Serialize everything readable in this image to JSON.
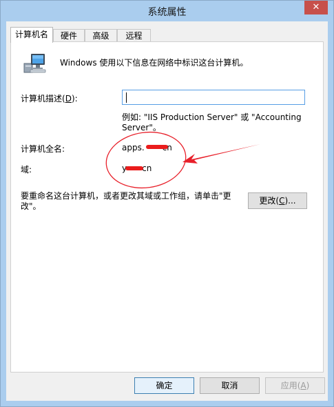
{
  "window": {
    "title": "系统属性",
    "close_label": "✕"
  },
  "tabs": [
    {
      "label": "计算机名",
      "active": true
    },
    {
      "label": "硬件",
      "active": false
    },
    {
      "label": "高级",
      "active": false
    },
    {
      "label": "远程",
      "active": false
    }
  ],
  "computer_name": {
    "intro": "Windows 使用以下信息在网络中标识这台计算机。",
    "description_label_pre": "计算机描述(",
    "description_label_key": "D",
    "description_label_post": "):",
    "description_value": "",
    "example_text": "例如: \"IIS Production Server\" 或 \"Accounting Server\"。",
    "full_name_label": "计算机全名:",
    "full_name_prefix": "apps.",
    "full_name_suffix": "cn",
    "domain_label": "域:",
    "domain_prefix": "y",
    "domain_suffix": "cn",
    "rename_hint": "要重命名这台计算机，或者更改其域或工作组，请单击\"更改\"。",
    "change_button_pre": "更改(",
    "change_button_key": "C",
    "change_button_post": ")..."
  },
  "footer": {
    "ok_label": "确定",
    "cancel_label": "取消",
    "apply_pre": "应用(",
    "apply_key": "A",
    "apply_post": ")"
  },
  "colors": {
    "annotation_red": "#e8202a",
    "title_bar": "#aacdee",
    "close_button": "#c7504b"
  },
  "icons": {
    "computer": "computer-icon",
    "close": "close-icon"
  }
}
